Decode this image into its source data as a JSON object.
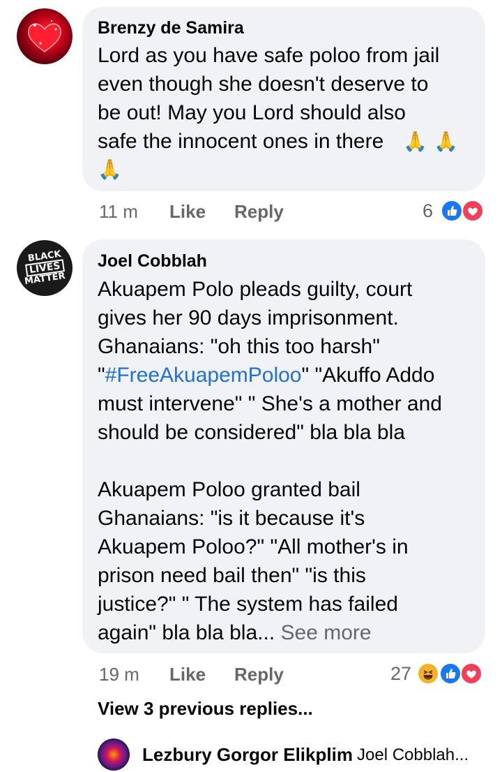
{
  "comments": [
    {
      "author": "Brenzy de Samira",
      "lines": [
        "Lord as you have safe poloo from jail",
        "even though she doesn't deserve to",
        "be out! May you Lord should also",
        "safe the innocent ones in there",
        ""
      ],
      "emoji": [
        "🙏",
        "🙏",
        "🙏"
      ],
      "time": "11 m",
      "like_label": "Like",
      "reply_label": "Reply",
      "reaction_count": "6",
      "reactions": [
        "like-icon",
        "love-icon"
      ]
    },
    {
      "author": "Joel Cobblah",
      "avatar_text": [
        "BLACK",
        "LIVES",
        "MATTER"
      ],
      "lines": [
        "Akuapem Polo pleads guilty, court",
        "gives her 90 days imprisonment.",
        "Ghanaians: \"oh this too harsh\"",
        "\"#FreeAkuapemPoloo\" \"Akuffo Addo",
        "must intervene\" \" She's a mother and",
        "should be considered\" bla bla bla",
        "",
        "Akuapem Poloo granted bail",
        "Ghanaians: \"is it because it's",
        "Akuapem Poloo?\" \"All mother's in",
        "prison need bail then\" \"is this",
        "justice?\" \" The system has failed",
        "again\" bla bla bla..."
      ],
      "hashtag": "#FreeAkuapemPoloo",
      "see_more": "See more",
      "time": "19 m",
      "like_label": "Like",
      "reply_label": "Reply",
      "reaction_count": "27",
      "reactions": [
        "haha-icon",
        "like-icon",
        "love-icon"
      ]
    }
  ],
  "view_previous_replies": "View 3 previous replies...",
  "latest_reply": {
    "author": "Lezbury Gorgor Elikplim",
    "snippet": "Joel Cobblah..."
  },
  "colors": {
    "bubble": "#f0f2f5",
    "meta": "#65676b",
    "link": "#216fdb",
    "like": "#1877f2",
    "love": "#f33e58",
    "haha": "#f7b125"
  }
}
